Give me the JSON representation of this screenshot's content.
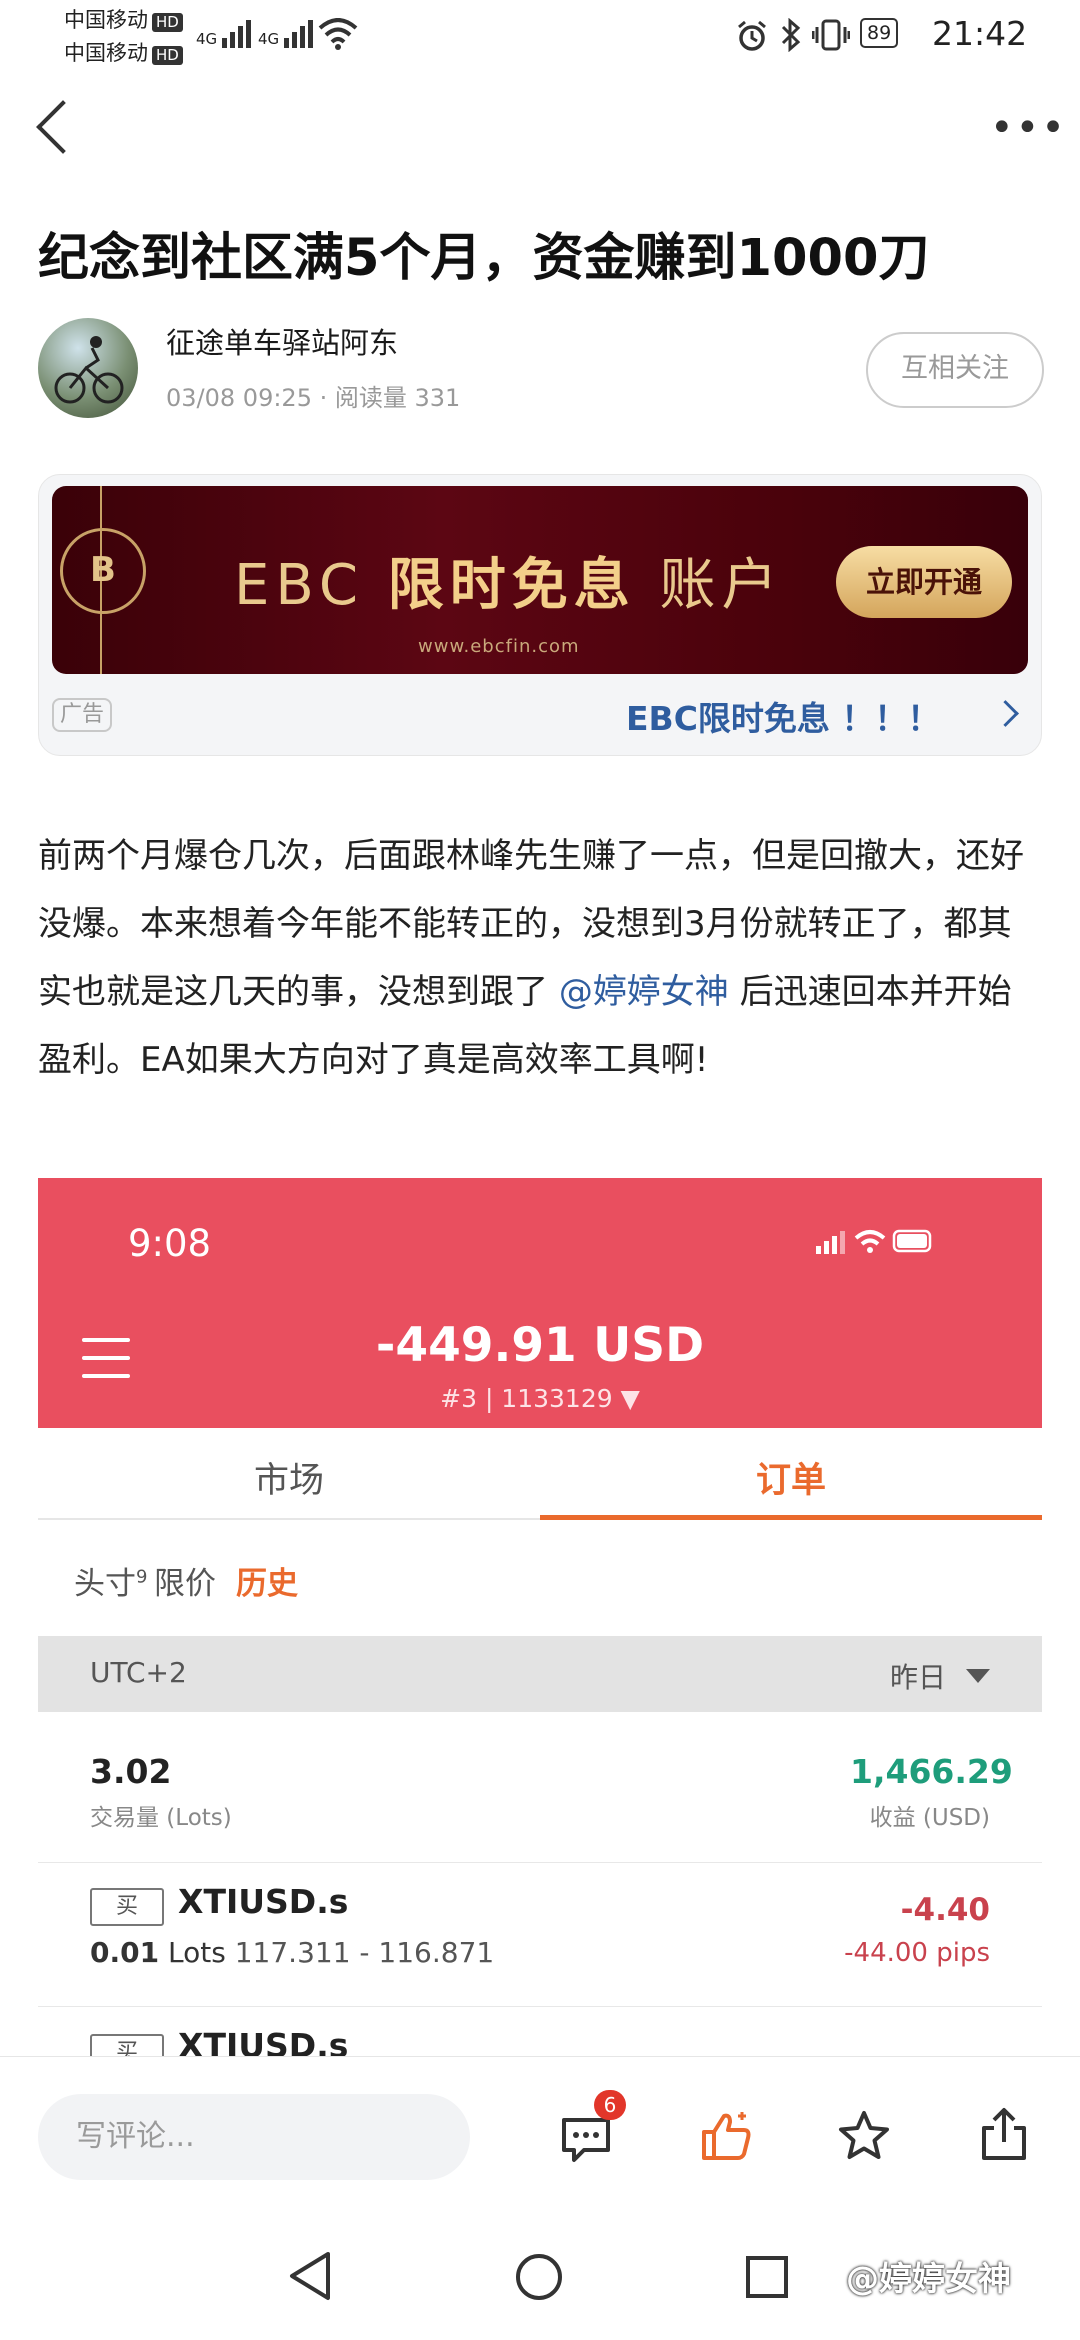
{
  "status_bar": {
    "carrier1": "中国移动",
    "carrier2": "中国移动",
    "hd": "HD",
    "signal1": "4G",
    "signal2": "4G",
    "battery": "89",
    "time": "21:42"
  },
  "post": {
    "title": "纪念到社区满5个月，资金赚到1000刀",
    "author": "征途单车驿站阿东",
    "meta": "03/08 09:25 · 阅读量 331",
    "follow_label": "互相关注",
    "body_part1": "前两个月爆仓几次，后面跟林峰先生赚了一点，但是回撤大，还好没爆。本来想着今年能不能转正的，没想到3月份就转正了，都其实也就是这几天的事，没想到跟了 ",
    "mention": "@婷婷女神",
    "body_part2": " 后迅速回本并开始盈利。EA如果大方向对了真是高效率工具啊!"
  },
  "ad": {
    "logo": "B",
    "title_prefix": "EBC ",
    "title_bold": "限时免息",
    "title_suffix": " 账户",
    "url": "www.ebcfin.com",
    "button": "立即开通",
    "tag": "广告",
    "link_text": "EBC限时免息 ！！！"
  },
  "screenshot": {
    "time": "9:08",
    "balance": "-449.91 USD",
    "account": "#3 | 1133129",
    "tabs": [
      "市场",
      "订单"
    ],
    "subtabs": [
      "头寸",
      "限价",
      "历史"
    ],
    "subtab_badge": "9",
    "timezone": "UTC+2",
    "period": "昨日",
    "volume": "3.02",
    "volume_label": "交易量 (Lots)",
    "profit": "1,466.29",
    "profit_label": "收益 (USD)",
    "trades": [
      {
        "side": "买",
        "symbol": "XTIUSD.s",
        "lots": "0.01",
        "lots_unit": "Lots",
        "prices": "117.311 - 116.871",
        "pnl": "-4.40",
        "pips": "-44.00 pips"
      },
      {
        "side": "买",
        "symbol": "XTIUSD.s"
      }
    ]
  },
  "bottom_bar": {
    "comment_placeholder": "写评论...",
    "comment_count": "6"
  },
  "watermark": "@婷婷女神"
}
